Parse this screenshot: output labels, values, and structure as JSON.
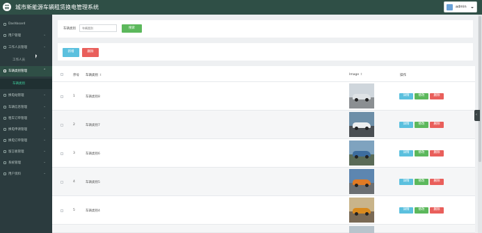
{
  "header": {
    "app_title": "城市新能源车辆租赁换电管理系统",
    "username": "admin"
  },
  "sidebar": {
    "items": [
      {
        "label": "Dashboard",
        "icon": "dashboard-icon"
      },
      {
        "label": "用户管理",
        "icon": "users-icon"
      },
      {
        "label": "工作人员管理",
        "icon": "staff-icon"
      },
      {
        "label": "工作人员",
        "icon": ""
      },
      {
        "label": "车辆类别管理",
        "icon": "category-icon"
      },
      {
        "label": "车辆类别",
        "icon": ""
      },
      {
        "label": "换电站管理",
        "icon": "station-icon"
      },
      {
        "label": "车辆信息管理",
        "icon": "car-icon"
      },
      {
        "label": "租车订单管理",
        "icon": "order-icon"
      },
      {
        "label": "换电申请管理",
        "icon": "swap-icon"
      },
      {
        "label": "换电订单管理",
        "icon": "swap-order-icon"
      },
      {
        "label": "留言板管理",
        "icon": "message-icon"
      },
      {
        "label": "系统管理",
        "icon": "system-icon"
      },
      {
        "label": "用户资料",
        "icon": "profile-icon"
      }
    ]
  },
  "search": {
    "label": "车辆类别",
    "placeholder": "车辆类别",
    "button": "搜索"
  },
  "toolbar": {
    "add": "新增",
    "delete": "删除"
  },
  "table": {
    "columns": {
      "index": "序号",
      "name": "车辆类别",
      "image": "Image",
      "actions": "操作"
    },
    "rows": [
      {
        "index": "1",
        "name": "车辆类别8"
      },
      {
        "index": "2",
        "name": "车辆类别7"
      },
      {
        "index": "3",
        "name": "车辆类别6"
      },
      {
        "index": "4",
        "name": "车辆类别5"
      },
      {
        "index": "5",
        "name": "车辆类别4"
      }
    ],
    "actions": {
      "detail": "详情",
      "edit": "修改",
      "delete": "删除"
    }
  },
  "colors": {
    "header": "#2f4f46",
    "sidebar": "#2b3b3e",
    "accent": "#3fcf9e",
    "primary_green": "#5cb85c",
    "info_blue": "#5bc0de",
    "danger_red": "#e95f5b"
  }
}
